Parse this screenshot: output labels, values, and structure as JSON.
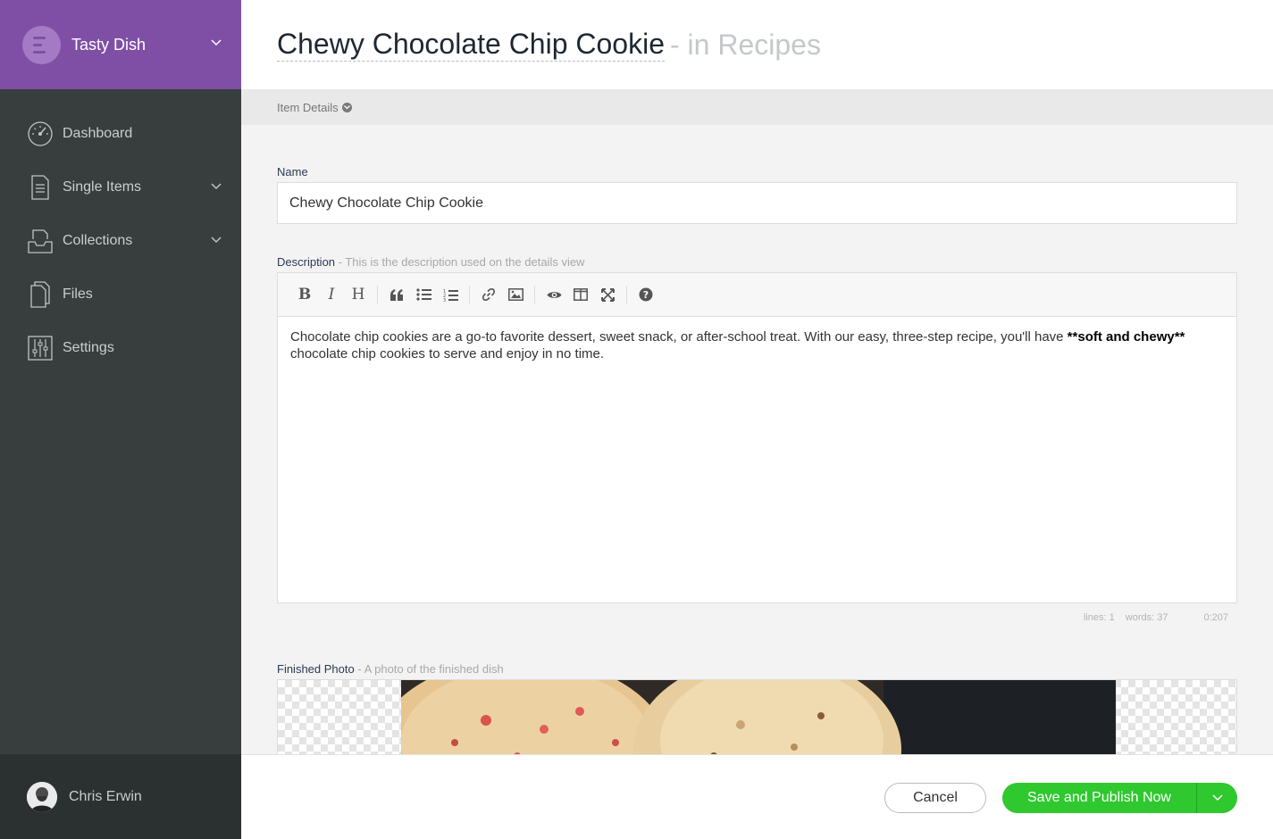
{
  "brand": {
    "name": "Tasty Dish",
    "accent": "#7f4fa6"
  },
  "sidebar": {
    "items": [
      {
        "label": "Dashboard",
        "icon": "dashboard-gauge-icon",
        "has_caret": false
      },
      {
        "label": "Single Items",
        "icon": "document-icon",
        "has_caret": true
      },
      {
        "label": "Collections",
        "icon": "inbox-tray-icon",
        "has_caret": true
      },
      {
        "label": "Files",
        "icon": "files-icon",
        "has_caret": false
      },
      {
        "label": "Settings",
        "icon": "sliders-icon",
        "has_caret": false
      }
    ],
    "user": {
      "name": "Chris Erwin"
    }
  },
  "header": {
    "title": "Chewy Chocolate Chip Cookie",
    "context": "- in Recipes"
  },
  "subbar": {
    "label": "Item Details"
  },
  "form": {
    "name": {
      "label": "Name",
      "value": "Chewy Chocolate Chip Cookie"
    },
    "description": {
      "label": "Description",
      "help": "- This is the description used on the details view",
      "text_before": "Chocolate chip cookies are a go-to favorite dessert, sweet snack, or after-school treat. With our easy, three-step recipe, you'll have ",
      "text_bold": "**soft and chewy**",
      "text_after": " chocolate chip cookies to serve and enjoy in no time.",
      "status": {
        "lines": "lines: 1",
        "words": "words: 37",
        "cursor": "0:207"
      }
    },
    "photo": {
      "label": "Finished Photo",
      "help": "- A photo of the finished dish"
    }
  },
  "footer": {
    "cancel_label": "Cancel",
    "publish_label": "Save and Publish Now",
    "publish_color": "#2fc82f"
  }
}
